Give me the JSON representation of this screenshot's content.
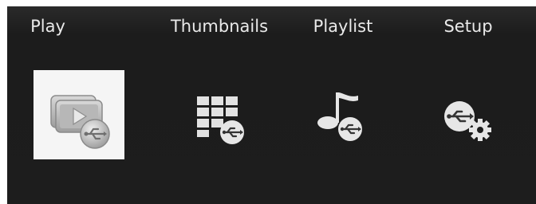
{
  "menu": {
    "selected": "play",
    "items": [
      {
        "id": "play",
        "label": "Play",
        "icon": "play-usb-icon"
      },
      {
        "id": "thumbnails",
        "label": "Thumbnails",
        "icon": "thumbnails-usb-icon"
      },
      {
        "id": "playlist",
        "label": "Playlist",
        "icon": "playlist-usb-icon"
      },
      {
        "id": "setup",
        "label": "Setup",
        "icon": "setup-usb-icon"
      }
    ]
  },
  "colors": {
    "background": "#1d1d1d",
    "label_text": "#e9e9e9",
    "selection_tile": "#f5f5f5",
    "icon_light": "#e6e6e6",
    "icon_muted": "#a8a8a8"
  }
}
